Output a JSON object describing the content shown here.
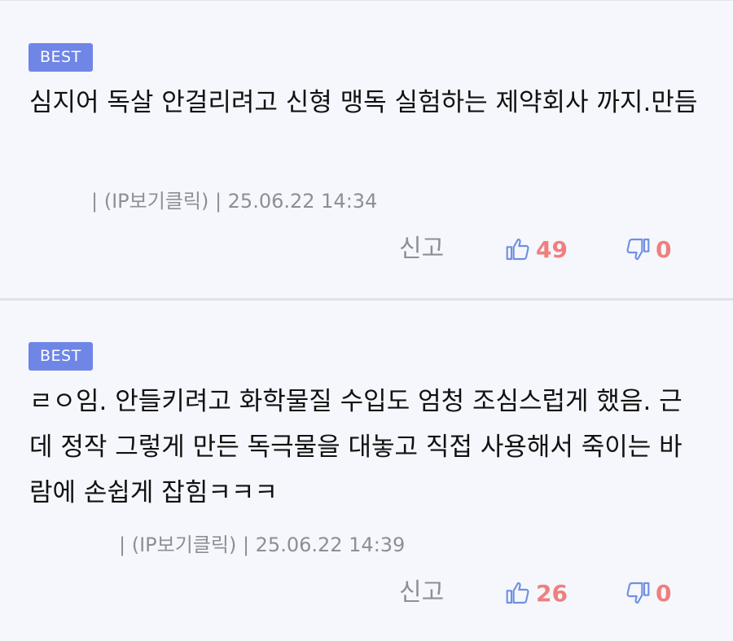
{
  "comments": [
    {
      "badge": "BEST",
      "text": "심지어 독살 안걸리려고 신형 맹독 실험하는 제약회사 까지.만듬",
      "meta": "| (IP보기클릭) | 25.06.22 14:34",
      "report_label": "신고",
      "likes": "49",
      "dislikes": "0"
    },
    {
      "badge": "BEST",
      "text": "ㄹㅇ임. 안들키려고 화학물질 수입도 엄청 조심스럽게 했음. 근데 정작 그렇게 만든 독극물을 대놓고 직접 사용해서 죽이는 바람에 손쉽게 잡힘ㅋㅋㅋ",
      "meta": "| (IP보기클릭) | 25.06.22 14:39",
      "report_label": "신고",
      "likes": "26",
      "dislikes": "0"
    }
  ],
  "colors": {
    "badge_bg": "#6f86e6",
    "vote_count": "#ef7f7f",
    "thumb_up": "#6f8fe3",
    "thumb_down": "#6f8fe3",
    "background": "#f5f7fc"
  },
  "icons": {
    "like": "thumbs-up-icon",
    "dislike": "thumbs-down-icon"
  }
}
